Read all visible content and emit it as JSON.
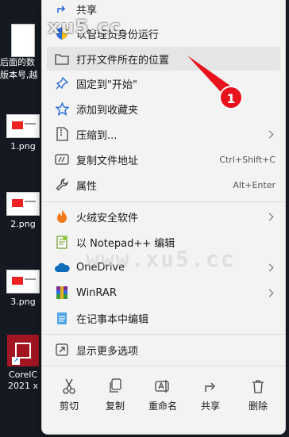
{
  "desktop": {
    "texts": [
      "后面的数",
      "版本号,越",
      "1.png",
      "2.png",
      "3.png",
      "CorelC",
      "2021 x"
    ]
  },
  "watermark": {
    "top": "xu5.cc",
    "middle": "www.xu5.cc"
  },
  "menu": {
    "items": [
      {
        "label": "共享",
        "icon": "share-icon"
      },
      {
        "label": "以管理员身份运行",
        "icon": "shield-icon"
      },
      {
        "label": "打开文件所在的位置",
        "icon": "folder-icon"
      },
      {
        "label": "固定到\"开始\"",
        "icon": "pin-icon"
      },
      {
        "label": "添加到收藏夹",
        "icon": "star-icon"
      },
      {
        "label": "压缩到...",
        "icon": "zip-icon"
      },
      {
        "label": "复制文件地址",
        "icon": "copy-path-icon",
        "shortcut": "Ctrl+Shift+C"
      },
      {
        "label": "属性",
        "icon": "wrench-icon",
        "shortcut": "Alt+Enter"
      },
      {
        "label": "火绒安全软件",
        "icon": "huorong-icon"
      },
      {
        "label": "以 Notepad++ 编辑",
        "icon": "notepadpp-icon"
      },
      {
        "label": "OneDrive",
        "icon": "onedrive-icon"
      },
      {
        "label": "WinRAR",
        "icon": "winrar-icon"
      },
      {
        "label": "在记事本中编辑",
        "icon": "notepad-icon"
      },
      {
        "label": "显示更多选项",
        "icon": "more-options-icon"
      }
    ],
    "actions": [
      {
        "label": "剪切",
        "icon": "scissors-icon"
      },
      {
        "label": "复制",
        "icon": "copy-icon"
      },
      {
        "label": "重命名",
        "icon": "rename-icon"
      },
      {
        "label": "共享",
        "icon": "share-icon"
      },
      {
        "label": "删除",
        "icon": "trash-icon"
      }
    ]
  },
  "annotation": {
    "number": "1"
  },
  "colors": {
    "accent": "#e8121c",
    "menu_bg": "#f3f3f3",
    "hover": "#e5e5e5"
  }
}
